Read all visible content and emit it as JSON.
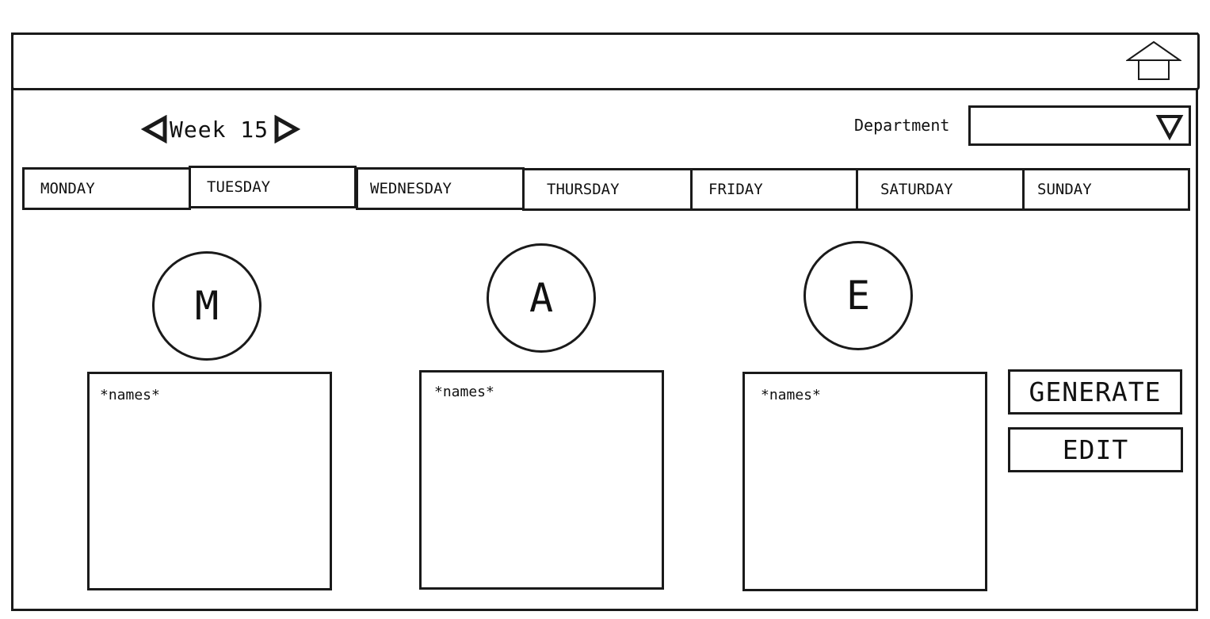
{
  "header": {
    "home_icon": "home-icon"
  },
  "week_nav": {
    "label": "Week 15",
    "prev_icon": "triangle-left-icon",
    "next_icon": "triangle-right-icon"
  },
  "department": {
    "label": "Department",
    "value": "",
    "dropdown_icon": "triangle-down-icon"
  },
  "days": [
    "MONDAY",
    "TUESDAY",
    "WEDNESDAY",
    "THURSDAY",
    "FRIDAY",
    "SATURDAY",
    "SUNDAY"
  ],
  "shifts": [
    {
      "letter": "M",
      "names": "*names*"
    },
    {
      "letter": "A",
      "names": "*names*"
    },
    {
      "letter": "E",
      "names": "*names*"
    }
  ],
  "actions": {
    "generate_label": "GENERATE",
    "edit_label": "EDIT"
  }
}
